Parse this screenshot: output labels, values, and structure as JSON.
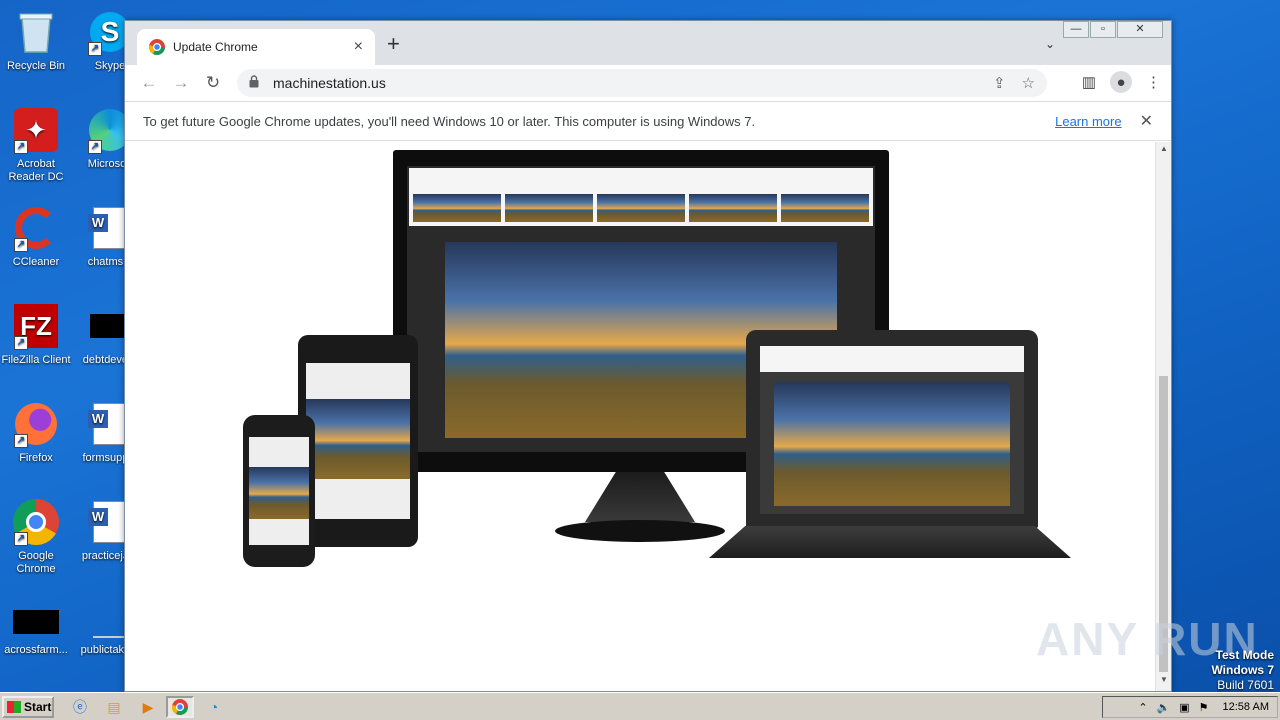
{
  "desktop": {
    "icons": [
      {
        "label": "Recycle Bin"
      },
      {
        "label": "Skype"
      },
      {
        "label": "Acrobat Reader DC"
      },
      {
        "label": "Microsoft"
      },
      {
        "label": "CCleaner"
      },
      {
        "label": "chatms..."
      },
      {
        "label": "FileZilla Client"
      },
      {
        "label": "debtdeve..."
      },
      {
        "label": "Firefox"
      },
      {
        "label": "formsupp..."
      },
      {
        "label": "Google Chrome"
      },
      {
        "label": "practiceja..."
      },
      {
        "label": "acrossfarm..."
      },
      {
        "label": "publictake..."
      }
    ]
  },
  "browser": {
    "tab_title": "Update Chrome",
    "tab_close": "×",
    "new_tab": "+",
    "tab_search": "⌄",
    "window_controls": {
      "minimize": "—",
      "maximize": "▫",
      "close": "✕"
    },
    "url": "machinestation.us",
    "infobar": {
      "message": "To get future Google Chrome updates, you'll need Windows 10 or later. This computer is using Windows 7.",
      "link": "Learn more",
      "close": "✕"
    }
  },
  "watermark": {
    "text": "ANY RUN",
    "mode_line1": "Test Mode",
    "mode_line2": "Windows 7",
    "mode_line3": "Build 7601"
  },
  "taskbar": {
    "start_label": "Start",
    "clock": "12:58 AM"
  }
}
